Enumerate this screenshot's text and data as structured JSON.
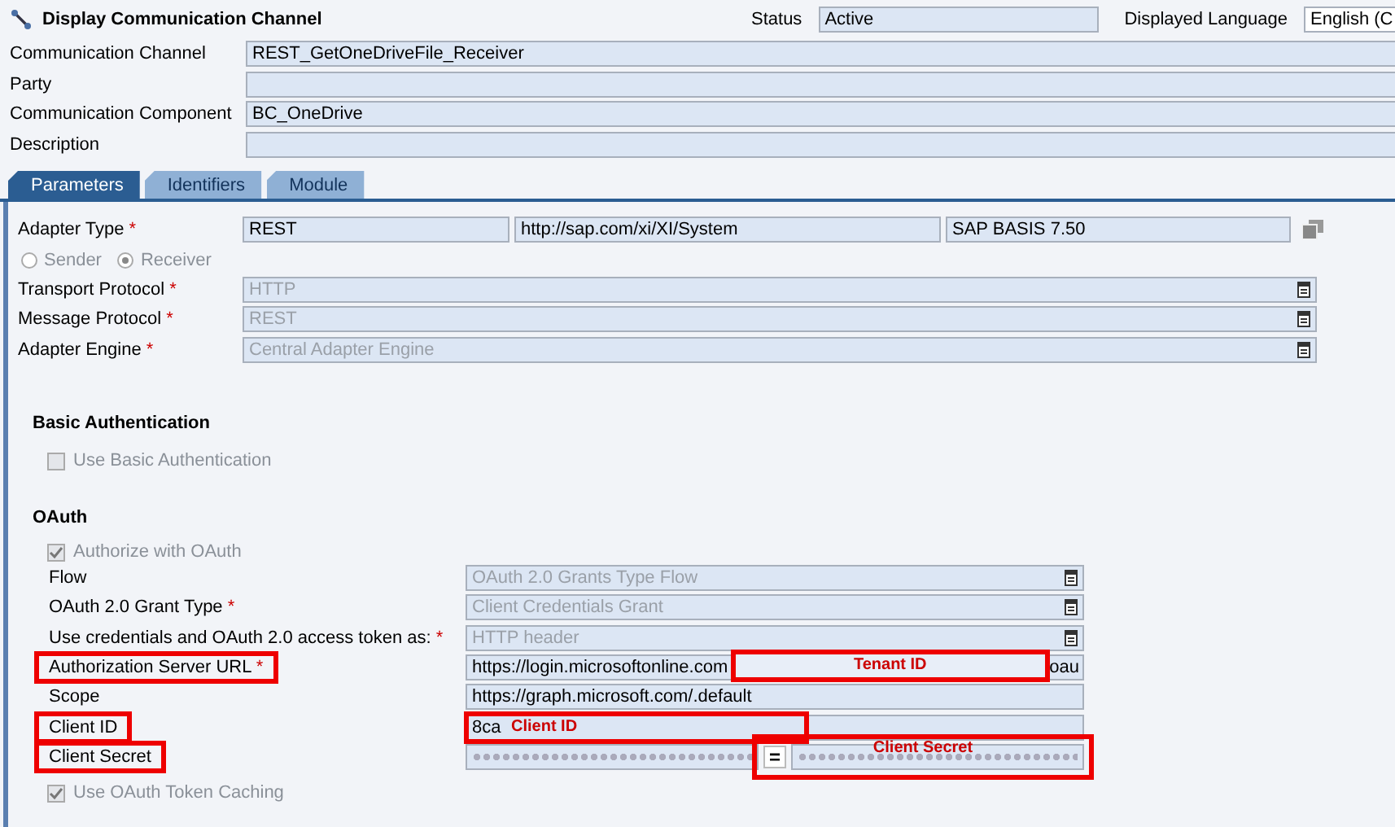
{
  "window": {
    "title": "Display Communication Channel"
  },
  "status": {
    "label": "Status",
    "value": "Active"
  },
  "language": {
    "label": "Displayed Language",
    "value": "English (C"
  },
  "header_fields": [
    {
      "label": "Communication Channel",
      "value": "REST_GetOneDriveFile_Receiver"
    },
    {
      "label": "Party"
    },
    {
      "label": "Communication Component",
      "value": "BC_OneDrive"
    },
    {
      "label": "Description"
    }
  ],
  "tabs": [
    {
      "label": "Parameters",
      "selected": true
    },
    {
      "label": "Identifiers",
      "selected": false
    },
    {
      "label": "Module",
      "selected": false
    }
  ],
  "adapter": {
    "label": "Adapter Type",
    "marker": "*",
    "values": [
      "REST",
      "http://sap.com/xi/XI/System",
      "SAP BASIS 7.50"
    ]
  },
  "direction": [
    {
      "label": "Sender",
      "selected": false
    },
    {
      "label": "Receiver",
      "selected": true
    }
  ],
  "adapter_fields": [
    {
      "label": "Transport Protocol",
      "marker": "*",
      "disabled": true,
      "value": "HTTP"
    },
    {
      "label": "Message Protocol",
      "marker": "*",
      "disabled": true,
      "value": "REST"
    },
    {
      "label": "Adapter Engine",
      "marker": "*",
      "disabled": true,
      "value": "Central Adapter Engine"
    }
  ],
  "basic_auth": {
    "title": "Basic Authentication",
    "checkbox": {
      "label": "Use Basic Authentication",
      "checked": false
    }
  },
  "oauth": {
    "title": "OAuth",
    "authorize": {
      "label": "Authorize with OAuth",
      "checked": true
    },
    "fields": [
      {
        "kind": "dropdown",
        "label": "Flow",
        "highlighted": false,
        "disabled": true,
        "value": "OAuth 2.0 Grants Type Flow"
      },
      {
        "kind": "dropdown",
        "label": "OAuth 2.0 Grant Type",
        "marker": "*",
        "highlighted": false,
        "disabled": true,
        "value": "Client Credentials Grant"
      },
      {
        "kind": "dropdown",
        "label": "Use credentials and OAuth 2.0 access token as:",
        "marker": "*",
        "highlighted": false,
        "disabled": true,
        "value": "HTTP header"
      },
      {
        "kind": "text",
        "label": "Authorization Server URL",
        "marker": "*",
        "highlighted": true,
        "value": "https://login.microsoftonline.com",
        "annotation": "Tenant ID",
        "suffix": "oau"
      },
      {
        "kind": "text",
        "label": "Scope",
        "highlighted": false,
        "value": "https://graph.microsoft.com/.default"
      },
      {
        "kind": "text",
        "label": "Client ID",
        "highlighted": true,
        "value": "8ca",
        "annotation": "Client ID"
      },
      {
        "kind": "secret",
        "label": "Client Secret",
        "highlighted": true,
        "confirm": "=",
        "annotation": "Client Secret"
      }
    ],
    "caching": {
      "label": "Use OAuth Token Caching",
      "checked": true
    }
  }
}
